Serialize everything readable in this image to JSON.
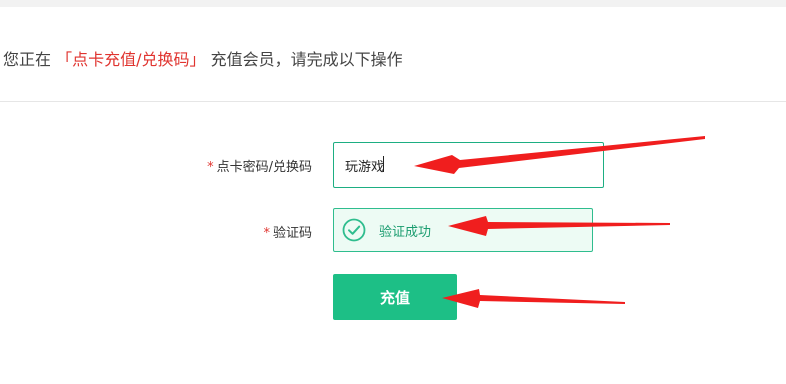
{
  "notice": {
    "prefix": "您正在",
    "method": "「点卡充值/兑换码」",
    "suffix": " 充值会员，请完成以下操作"
  },
  "form": {
    "code_field": {
      "required_mark": "*",
      "label": "点卡密码/兑换码",
      "value": "玩游戏"
    },
    "captcha_field": {
      "required_mark": "*",
      "label": "验证码",
      "status_text": "验证成功"
    },
    "submit_label": "充值"
  },
  "colors": {
    "accent_green": "#1dbf86",
    "success_text": "#1a9c6f",
    "highlight_red": "#e0342f",
    "arrow_red": "#f01e1e"
  },
  "icons": {
    "captcha_status": "check-circle-icon",
    "annotations": "arrow-icon"
  }
}
